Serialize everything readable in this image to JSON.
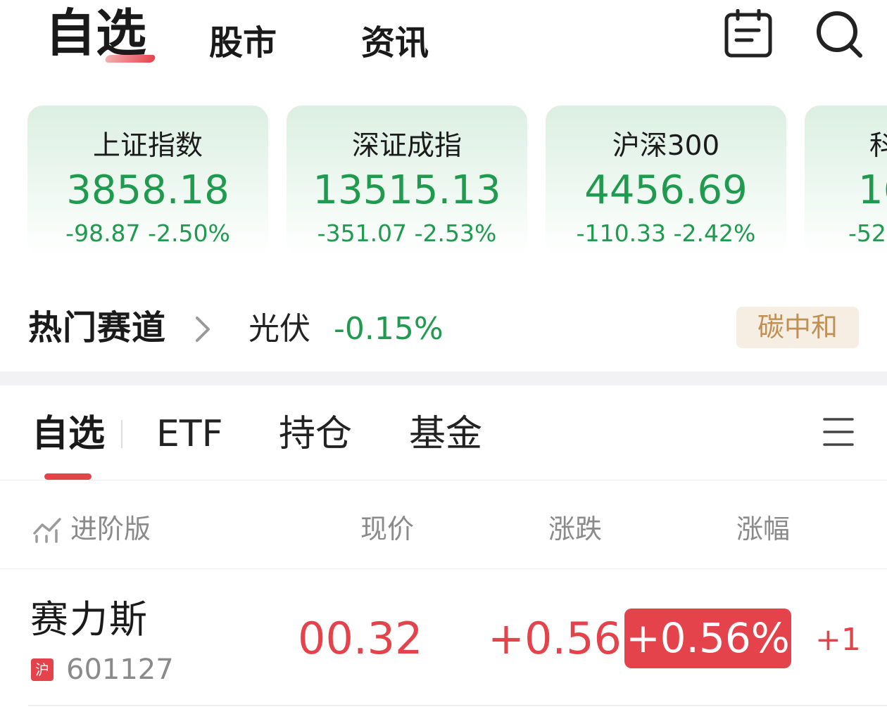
{
  "header": {
    "tabs": [
      {
        "label": "自选",
        "active": true
      },
      {
        "label": "股市",
        "active": false
      },
      {
        "label": "资讯",
        "active": false
      }
    ],
    "icons": [
      "calendar-icon",
      "search-icon"
    ]
  },
  "indices": [
    {
      "name": "上证指数",
      "value": "3858.18",
      "change": "-98.87",
      "percent": "-2.50%"
    },
    {
      "name": "深证成指",
      "value": "13515.13",
      "change": "-351.07",
      "percent": "-2.53%"
    },
    {
      "name": "沪深300",
      "value": "4456.69",
      "change": "-110.33",
      "percent": "-2.42%"
    },
    {
      "name": "科",
      "value": "16",
      "change": "-52",
      "percent": ""
    }
  ],
  "hot_track": {
    "title": "热门赛道",
    "sector": "光伏",
    "change": "-0.15%",
    "tag": "碳中和"
  },
  "sub_tabs": [
    {
      "label": "自选",
      "active": true
    },
    {
      "label": "ETF",
      "active": false
    },
    {
      "label": "持仓",
      "active": false
    },
    {
      "label": "基金",
      "active": false
    }
  ],
  "columns": {
    "advanced": "进阶版",
    "price": "现价",
    "change": "涨跌",
    "percent": "涨幅"
  },
  "stocks": [
    {
      "name": "赛力斯",
      "market": "沪",
      "code": "601127",
      "price": "00.32",
      "change": "+0.56",
      "percent": "+0.56%",
      "extra": "+1"
    }
  ],
  "colors": {
    "up": "#e5434b",
    "down": "#1f9a4e",
    "tag_bg": "#f7eee3",
    "tag_text": "#c09052"
  }
}
